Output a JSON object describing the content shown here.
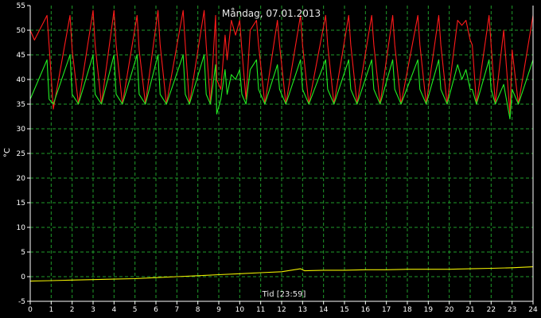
{
  "chart_data": {
    "type": "line",
    "title": "Måndag, 07.01.2013",
    "xlabel": "Tid [23:59]",
    "ylabel": "°C",
    "xlim": [
      0,
      24
    ],
    "ylim": [
      -5,
      55
    ],
    "x_ticks": [
      "0",
      "1",
      "2",
      "3",
      "4",
      "5",
      "6",
      "7",
      "8",
      "9",
      "10",
      "11",
      "12",
      "13",
      "14",
      "15",
      "16",
      "17",
      "18",
      "19",
      "20",
      "21",
      "22",
      "23",
      "24"
    ],
    "y_ticks": [
      "-5",
      "0",
      "5",
      "10",
      "15",
      "20",
      "25",
      "30",
      "35",
      "40",
      "45",
      "50",
      "55"
    ],
    "grid": true,
    "grid_color": "#1f9b2a",
    "background": "#000000",
    "series": [
      {
        "color": "#ff1a1a",
        "x": [
          0.0,
          0.2,
          0.8,
          0.9,
          1.1,
          1.9,
          2.0,
          2.3,
          3.0,
          3.1,
          3.4,
          4.0,
          4.1,
          4.4,
          5.1,
          5.2,
          5.5,
          6.1,
          6.2,
          6.5,
          7.3,
          7.4,
          7.6,
          8.3,
          8.4,
          8.6,
          8.85,
          8.9,
          9.1,
          9.3,
          9.4,
          9.6,
          9.8,
          10.0,
          10.1,
          10.3,
          10.5,
          10.8,
          10.9,
          11.2,
          11.8,
          11.9,
          12.2,
          12.9,
          13.0,
          13.3,
          14.1,
          14.2,
          14.5,
          15.2,
          15.3,
          15.6,
          16.3,
          16.4,
          16.7,
          17.3,
          17.4,
          17.7,
          18.5,
          18.6,
          18.9,
          19.5,
          19.6,
          19.9,
          20.4,
          20.6,
          20.8,
          21.0,
          21.1,
          21.3,
          21.9,
          22.0,
          22.2,
          22.6,
          22.9,
          23.0,
          23.3,
          24.0
        ],
        "y": [
          50,
          48,
          53,
          47,
          34,
          53,
          46,
          35,
          54,
          47,
          35,
          54,
          47,
          35,
          53,
          46,
          35,
          54,
          47,
          35,
          54,
          47,
          35,
          54,
          47,
          35,
          53,
          40,
          38,
          49,
          44,
          52,
          49,
          52,
          46,
          36,
          50,
          52,
          47,
          35,
          52,
          47,
          35,
          53,
          47,
          35,
          53,
          47,
          35,
          53,
          47,
          35,
          53,
          47,
          35,
          53,
          47,
          35,
          53,
          47,
          35,
          53,
          47,
          35,
          52,
          51,
          52,
          48,
          47,
          35,
          53,
          47,
          35,
          50,
          33,
          46,
          35,
          53
        ]
      },
      {
        "color": "#22ee22",
        "x": [
          0.0,
          0.2,
          0.8,
          0.9,
          1.1,
          1.9,
          2.0,
          2.3,
          3.0,
          3.1,
          3.4,
          4.0,
          4.1,
          4.4,
          5.1,
          5.2,
          5.5,
          6.1,
          6.2,
          6.5,
          7.3,
          7.4,
          7.6,
          8.3,
          8.4,
          8.6,
          8.85,
          8.9,
          9.1,
          9.3,
          9.4,
          9.6,
          9.8,
          10.0,
          10.1,
          10.3,
          10.5,
          10.8,
          10.9,
          11.2,
          11.8,
          11.9,
          12.2,
          12.9,
          13.0,
          13.3,
          14.1,
          14.2,
          14.5,
          15.2,
          15.3,
          15.6,
          16.3,
          16.4,
          16.7,
          17.3,
          17.4,
          17.7,
          18.5,
          18.6,
          18.9,
          19.5,
          19.6,
          19.9,
          20.4,
          20.6,
          20.8,
          21.0,
          21.1,
          21.3,
          21.9,
          22.0,
          22.2,
          22.6,
          22.9,
          23.0,
          23.3,
          24.0
        ],
        "y": [
          36,
          38,
          44,
          36,
          35,
          45,
          37,
          35,
          45,
          37,
          35,
          45,
          37,
          35,
          45,
          37,
          35,
          45,
          37,
          35,
          45,
          37,
          35,
          45,
          37,
          35,
          43,
          33,
          36,
          42,
          37,
          41,
          40,
          42,
          37,
          35,
          42,
          44,
          38,
          35,
          43,
          38,
          35,
          44,
          38,
          35,
          44,
          38,
          35,
          44,
          38,
          35,
          44,
          38,
          35,
          44,
          38,
          35,
          44,
          38,
          35,
          44,
          38,
          35,
          43,
          40,
          42,
          38,
          38,
          35,
          44,
          38,
          35,
          39,
          32,
          38,
          35,
          44
        ]
      },
      {
        "color": "#f0f000",
        "x": [
          0,
          1,
          2,
          3,
          4,
          5,
          6,
          7,
          8,
          9,
          10,
          11,
          12,
          12.9,
          13.1,
          14,
          15,
          16,
          17,
          18,
          19,
          20,
          21,
          22,
          23,
          24
        ],
        "y": [
          -0.9,
          -0.8,
          -0.7,
          -0.6,
          -0.5,
          -0.4,
          -0.2,
          0.0,
          0.2,
          0.4,
          0.6,
          0.8,
          1.0,
          1.6,
          1.2,
          1.3,
          1.3,
          1.4,
          1.4,
          1.5,
          1.5,
          1.5,
          1.6,
          1.7,
          1.8,
          2.0
        ]
      }
    ]
  }
}
